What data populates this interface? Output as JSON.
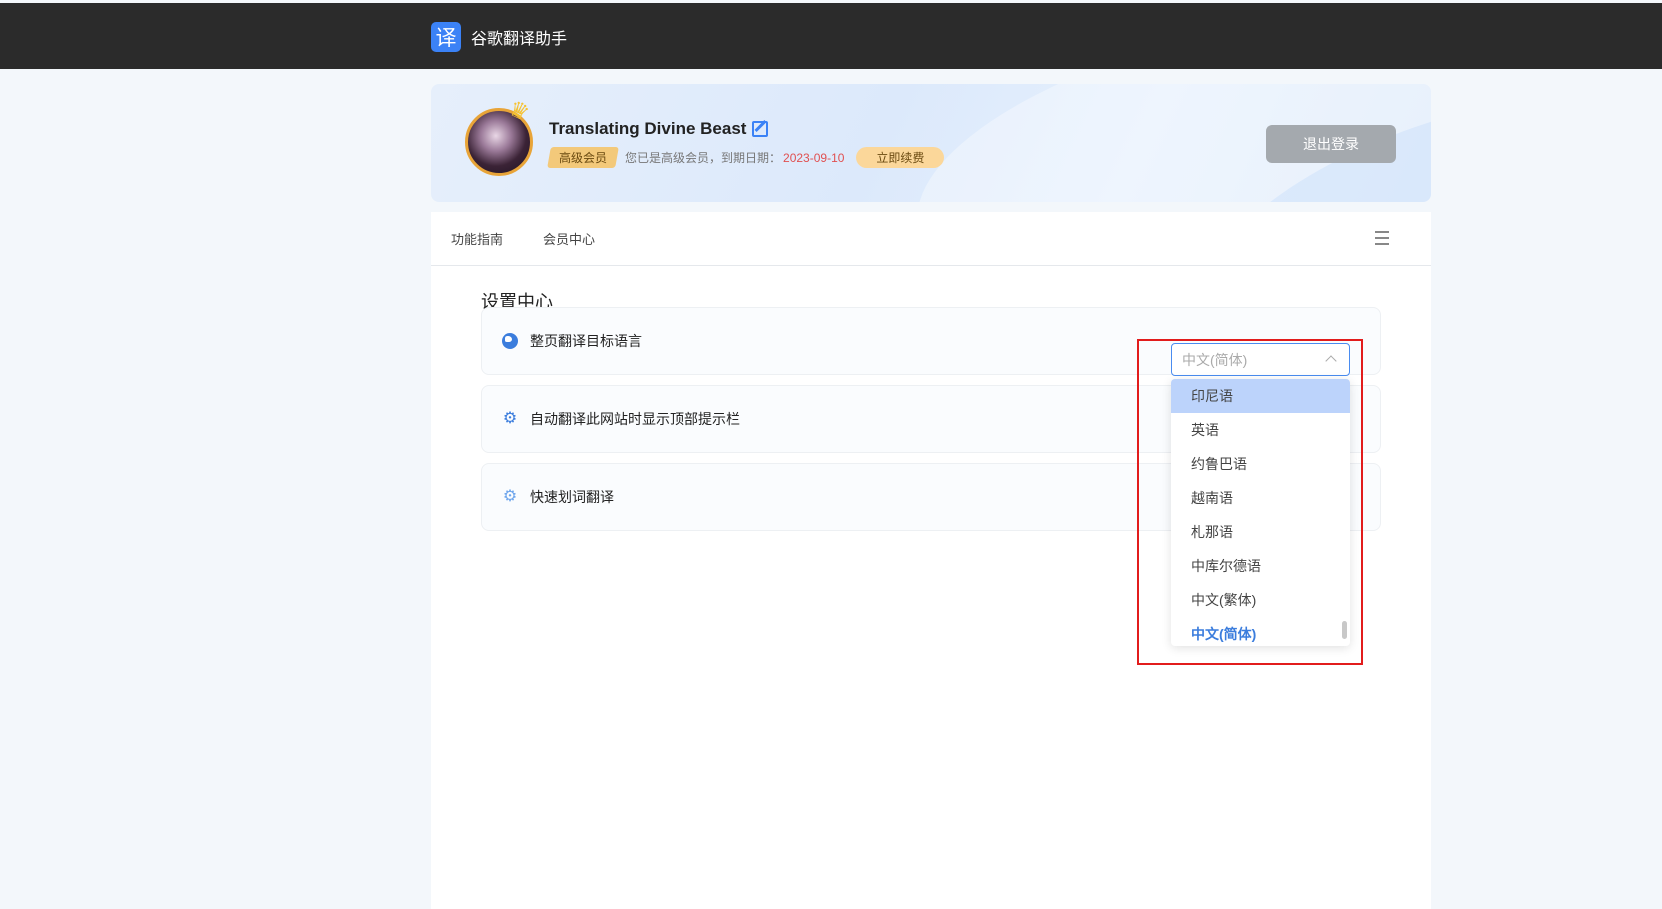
{
  "brand": {
    "logo_char": "译",
    "name": "谷歌翻译助手"
  },
  "profile": {
    "username": "Translating Divine Beast",
    "level_badge": "高级会员",
    "member_text": "您已是高级会员，到期日期：",
    "expire_date": "2023-09-10",
    "renew_label": "立即续费",
    "logout_label": "退出登录"
  },
  "tabs": [
    {
      "label": "功能指南"
    },
    {
      "label": "会员中心"
    }
  ],
  "settings": {
    "title": "设置中心",
    "rows": [
      {
        "label": "整页翻译目标语言",
        "icon": "globe-icon"
      },
      {
        "label": "自动翻译此网站时显示顶部提示栏",
        "icon": "gear-icon"
      },
      {
        "label": "快速划词翻译",
        "icon": "gear-icon"
      }
    ]
  },
  "language_select": {
    "placeholder": "中文(简体)",
    "options": [
      {
        "label": "印尼语",
        "state": "hover"
      },
      {
        "label": "英语",
        "state": ""
      },
      {
        "label": "约鲁巴语",
        "state": ""
      },
      {
        "label": "越南语",
        "state": ""
      },
      {
        "label": "札那语",
        "state": ""
      },
      {
        "label": "中库尔德语",
        "state": ""
      },
      {
        "label": "中文(繁体)",
        "state": ""
      },
      {
        "label": "中文(简体)",
        "state": "selected"
      }
    ]
  },
  "colors": {
    "accent": "#3b7ddd",
    "highlight_border": "#e21c1c",
    "topbar": "#2b2b2b"
  }
}
